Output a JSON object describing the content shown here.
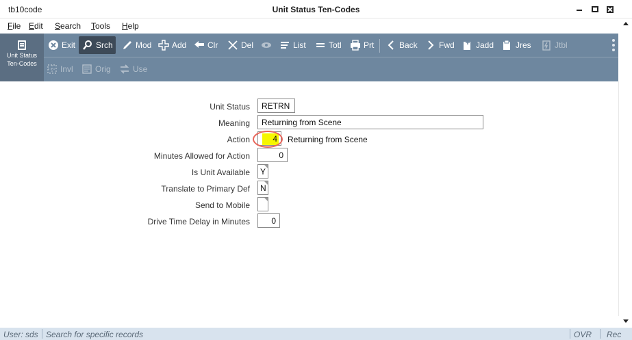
{
  "window": {
    "app_name": "tb10code",
    "title": "Unit Status Ten-Codes"
  },
  "menu": [
    "File",
    "Edit",
    "Search",
    "Tools",
    "Help"
  ],
  "mode": {
    "label_line1": "Unit Status",
    "label_line2": "Ten-Codes",
    "icon": "form-icon"
  },
  "toolbar": {
    "row1": [
      {
        "label": "Exit",
        "icon": "close-circle-icon"
      },
      {
        "label": "Srch",
        "icon": "search-icon"
      },
      {
        "label": "Mod",
        "icon": "pencil-icon"
      },
      {
        "label": "Add",
        "icon": "plus-icon"
      },
      {
        "label": "Clr",
        "icon": "undo-icon"
      },
      {
        "label": "Del",
        "icon": "x-icon"
      },
      {
        "label": "",
        "icon": "eye-icon"
      },
      {
        "label": "List",
        "icon": "list-icon"
      },
      {
        "label": "Totl",
        "icon": "equals-icon"
      },
      {
        "label": "Prt",
        "icon": "printer-icon"
      },
      {
        "label": "Back",
        "icon": "chevron-left-icon"
      },
      {
        "label": "Fwd",
        "icon": "chevron-right-icon"
      },
      {
        "label": "Jadd",
        "icon": "doc-plus-icon"
      },
      {
        "label": "Jres",
        "icon": "doc-icon"
      },
      {
        "label": "Jtbl",
        "icon": "doc-lightning-icon"
      }
    ],
    "row2": [
      {
        "label": "Invl",
        "icon": "dotted-box-icon"
      },
      {
        "label": "Orig",
        "icon": "doc-lines-icon"
      },
      {
        "label": "Use",
        "icon": "arrows-icon"
      }
    ]
  },
  "form": {
    "unit_status": {
      "label": "Unit Status",
      "value": "RETRN"
    },
    "meaning": {
      "label": "Meaning",
      "value": "Returning from Scene"
    },
    "action": {
      "label": "Action",
      "value": "4",
      "description": "Returning from Scene"
    },
    "minutes_allowed": {
      "label": "Minutes Allowed for Action",
      "value": "0"
    },
    "is_unit_available": {
      "label": "Is Unit Available",
      "value": "Y"
    },
    "translate_primary": {
      "label": "Translate to Primary Def",
      "value": "N"
    },
    "send_to_mobile": {
      "label": "Send to Mobile",
      "value": ""
    },
    "drive_time_delay": {
      "label": "Drive Time Delay in Minutes",
      "value": "0"
    }
  },
  "status": {
    "user": "User: sds",
    "message": "Search for specific records",
    "mode": "OVR",
    "rec": "Rec"
  },
  "colors": {
    "toolbar": "#6e879f",
    "mode_panel": "#5b6e82",
    "active_button": "#3d4a58",
    "highlight": "#f6f600",
    "ring": "#e8655a",
    "statusbar": "#d8e3ee"
  }
}
